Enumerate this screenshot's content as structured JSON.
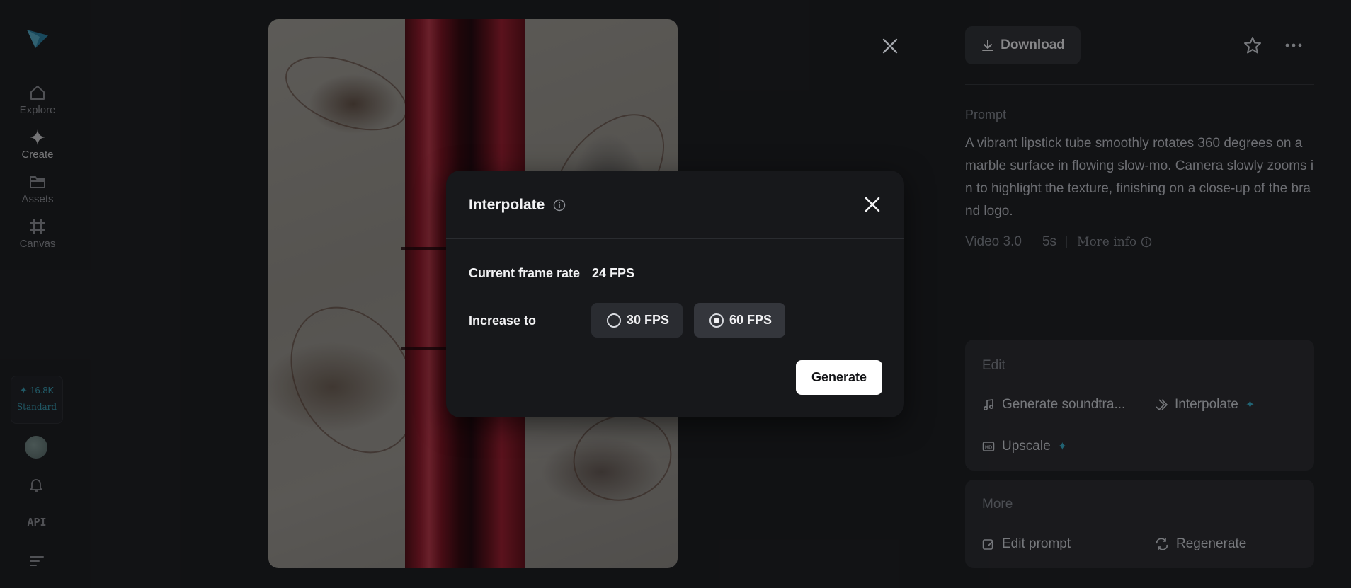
{
  "nav": {
    "items": [
      {
        "label": "Explore",
        "icon": "home-icon"
      },
      {
        "label": "Create",
        "icon": "sparkle-icon"
      },
      {
        "label": "Assets",
        "icon": "folder-icon"
      },
      {
        "label": "Canvas",
        "icon": "frame-icon"
      }
    ],
    "credits": {
      "amount": "16.8K",
      "plan": "Standard"
    },
    "api_label": "API"
  },
  "toolbar": {
    "download_label": "Download"
  },
  "prompt": {
    "label": "Prompt",
    "text": "A vibrant lipstick tube smoothly rotates 360 degrees on a marble surface in flowing slow-mo. Camera slowly zooms in to highlight the texture, finishing on a close-up of the brand logo."
  },
  "meta": {
    "model": "Video 3.0",
    "duration": "5s",
    "more_info": "More info"
  },
  "edit": {
    "title": "Edit",
    "generate_soundtrack": "Generate soundtra...",
    "interpolate": "Interpolate",
    "upscale": "Upscale"
  },
  "more": {
    "title": "More",
    "edit_prompt": "Edit prompt",
    "regenerate": "Regenerate"
  },
  "modal": {
    "title": "Interpolate",
    "current_label": "Current frame rate",
    "current_value": "24 FPS",
    "increase_label": "Increase to",
    "options": [
      {
        "label": "30 FPS",
        "selected": false
      },
      {
        "label": "60 FPS",
        "selected": true
      }
    ],
    "generate_label": "Generate"
  },
  "colors": {
    "accent": "#2fa6c2",
    "modal_bg": "#17181b",
    "page_bg": "#1b1c1f"
  }
}
